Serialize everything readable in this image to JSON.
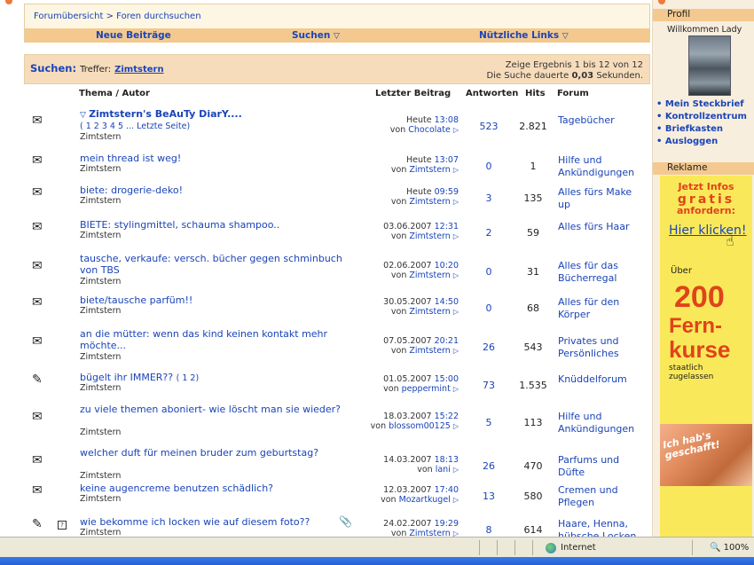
{
  "breadcrumb": {
    "home": "Forumübersicht",
    "sep": ">",
    "current": "Foren durchsuchen"
  },
  "nav": {
    "new_posts": "Neue Beiträge",
    "search": "Suchen",
    "useful_links": "Nützliche Links"
  },
  "search": {
    "title": "Suchen:",
    "hits_label": "Treffer:",
    "user": "Zimtstern",
    "info_line1": "Zeige Ergebnis 1 bis 12 von 12",
    "info_line2_prefix": "Die Suche dauerte",
    "duration": "0,03",
    "info_line2_suffix": "Sekunden."
  },
  "columns": {
    "topic": "Thema / Autor",
    "last_post": "Letzter Beitrag",
    "answers": "Antworten",
    "hits": "Hits",
    "forum": "Forum"
  },
  "rows": [
    {
      "title": "Zimtstern's BeAuTy DiarY....",
      "pages": "( 1 2 3 4 5 ... Letzte Seite)",
      "author": "Zimtstern",
      "date": "Heute",
      "time": "13:08",
      "by": "Chocolate",
      "answers": "523",
      "hits": "2.821",
      "forum": "Tagebücher",
      "icon": "envelope-icon"
    },
    {
      "title": "mein thread ist weg!",
      "author": "Zimtstern",
      "date": "Heute",
      "time": "13:07",
      "by": "Zimtstern",
      "answers": "0",
      "hits": "1",
      "forum": "Hilfe und Ankündigungen",
      "icon": "envelope-open-icon"
    },
    {
      "title": "biete: drogerie-deko!",
      "author": "Zimtstern",
      "date": "Heute",
      "time": "09:59",
      "by": "Zimtstern",
      "answers": "3",
      "hits": "135",
      "forum": "Alles fürs Make up",
      "icon": "envelope-open-icon"
    },
    {
      "title": "BIETE: stylingmittel, schauma shampoo..",
      "author": "Zimtstern",
      "date": "03.06.2007",
      "time": "12:31",
      "by": "Zimtstern",
      "answers": "2",
      "hits": "59",
      "forum": "Alles fürs Haar",
      "icon": "envelope-open-icon"
    },
    {
      "title": "tausche, verkaufe: versch. bücher gegen schminbuch von TBS",
      "author": "Zimtstern",
      "date": "02.06.2007",
      "time": "10:20",
      "by": "Zimtstern",
      "answers": "0",
      "hits": "31",
      "forum": "Alles für das Bücherregal",
      "icon": "envelope-open-icon"
    },
    {
      "title": "biete/tausche parfüm!!",
      "author": "Zimtstern",
      "date": "30.05.2007",
      "time": "14:50",
      "by": "Zimtstern",
      "answers": "0",
      "hits": "68",
      "forum": "Alles für den Körper",
      "icon": "envelope-open-icon"
    },
    {
      "title": "an die mütter: wenn das kind keinen kontakt mehr möchte...",
      "author": "Zimtstern",
      "date": "07.05.2007",
      "time": "20:21",
      "by": "Zimtstern",
      "answers": "26",
      "hits": "543",
      "forum": "Privates und Persönliches",
      "icon": "envelope-open-icon"
    },
    {
      "title": "bügelt ihr IMMER??",
      "pages": "( 1 2)",
      "author": "Zimtstern",
      "date": "01.05.2007",
      "time": "15:00",
      "by": "peppermint",
      "answers": "73",
      "hits": "1.535",
      "forum": "Knüddelforum",
      "icon": "envelope-edit-icon"
    },
    {
      "title": "zu viele themen aboniert- wie löscht man sie wieder?",
      "author": "Zimtstern",
      "date": "18.03.2007",
      "time": "15:22",
      "by": "blossom00125",
      "answers": "5",
      "hits": "113",
      "forum": "Hilfe und Ankündigungen",
      "icon": "envelope-open-icon"
    },
    {
      "title": "welcher duft für meinen bruder zum geburtstag?",
      "author": "Zimtstern",
      "date": "14.03.2007",
      "time": "18:13",
      "by": "lani",
      "answers": "26",
      "hits": "470",
      "forum": "Parfums und Düfte",
      "icon": "envelope-open-icon"
    },
    {
      "title": "keine augencreme benutzen schädlich?",
      "author": "Zimtstern",
      "date": "12.03.2007",
      "time": "17:40",
      "by": "Mozartkugel",
      "answers": "13",
      "hits": "580",
      "forum": "Cremen und Pflegen",
      "icon": "envelope-open-icon"
    },
    {
      "title": "wie bekomme ich locken wie auf diesem foto??",
      "author": "Zimtstern",
      "date": "24.02.2007",
      "time": "19:29",
      "by": "Zimtstern",
      "answers": "8",
      "hits": "614",
      "forum": "Haare, Henna, hübsche Locken",
      "icon": "envelope-edit-icon"
    }
  ],
  "sidebar": {
    "profile_title": "Profil",
    "welcome": "Willkommen Lady",
    "links": [
      "Mein Steckbrief",
      "Kontrollzentrum",
      "Briefkasten",
      "Ausloggen"
    ],
    "ad_title": "Reklame"
  },
  "ad": {
    "line1": "Jetzt Infos",
    "gratis": "gratis",
    "line3": "anfordern:",
    "click": "Hier klicken!",
    "ueber": "Über",
    "big": "200",
    "fern": "Fern-",
    "kurse": "kurse",
    "staat1": "staatlich",
    "staat2": "zugelassen",
    "bubble1": "Ich hab's",
    "bubble2": "geschafft!"
  },
  "status": {
    "zone": "Internet",
    "zoom": "100%"
  }
}
